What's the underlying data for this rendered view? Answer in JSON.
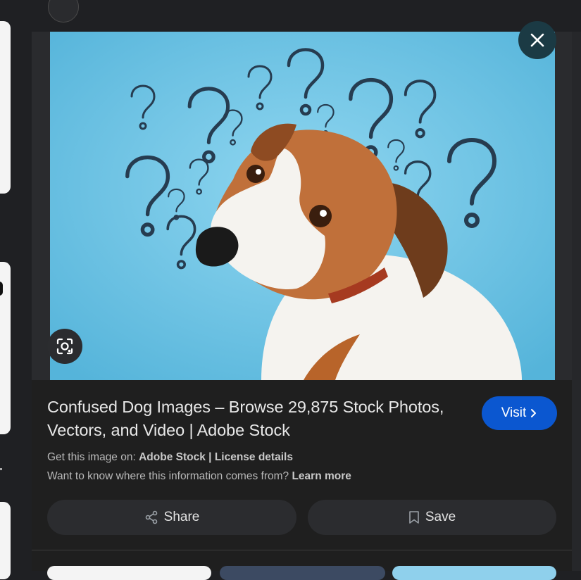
{
  "viewer": {
    "title": "Confused Dog Images – Browse 29,875 Stock Photos, Vectors, and Video | Adobe Stock",
    "visit_label": "Visit",
    "get_image_prefix": "Get this image on:",
    "source_name": "Adobe Stock",
    "separator": "|",
    "license_label": "License details",
    "info_question": "Want to know where this information comes from?",
    "learn_more_label": "Learn more",
    "share_label": "Share",
    "save_label": "Save"
  },
  "icons": {
    "close": "close-icon",
    "lens": "google-lens-icon",
    "share": "share-icon",
    "save": "bookmark-icon",
    "visit_arrow": "chevron-right-icon"
  },
  "colors": {
    "background": "#1f2023",
    "visit_button": "#0b57d0",
    "close_button": "#1b3a44",
    "action_button": "#2b2c2f",
    "image_background": "#7cc9e6"
  }
}
